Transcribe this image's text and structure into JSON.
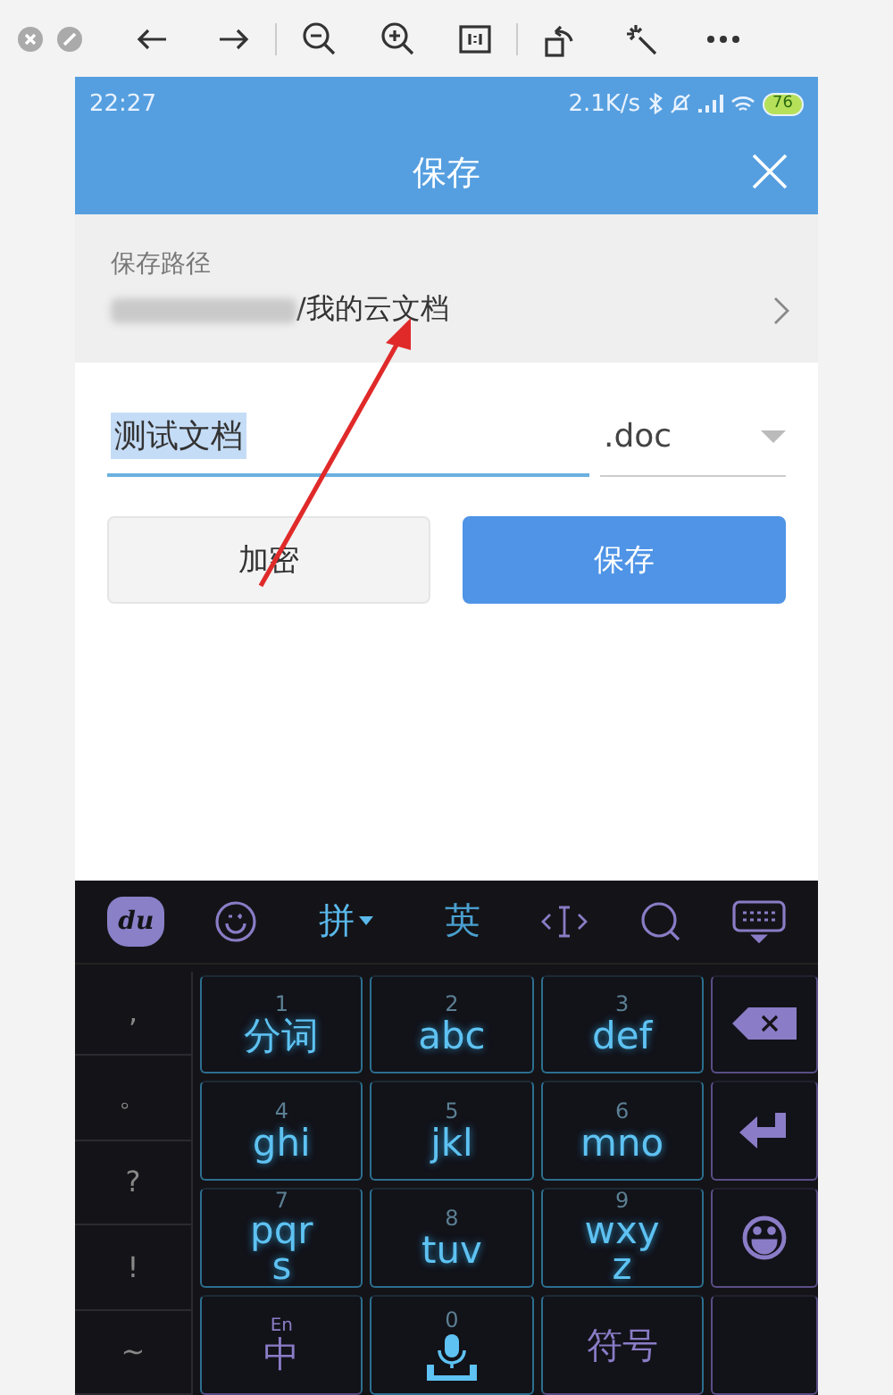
{
  "status_bar": {
    "time": "22:27",
    "speed": "2.1K/s",
    "battery": "76"
  },
  "header": {
    "title": "保存"
  },
  "save_path": {
    "label": "保存路径",
    "path": "/我的云文档"
  },
  "file_name": {
    "value": "测试文档",
    "highlighted": true
  },
  "format": {
    "value": ".doc"
  },
  "buttons": [
    {
      "label": "加密",
      "kind": "secondary"
    },
    {
      "label": "保存",
      "kind": "primary"
    }
  ],
  "keyboard": {
    "logo": "du",
    "toolbar": [
      {
        "kind": "emoji"
      },
      {
        "kind": "label",
        "label": "拼",
        "dropdown": true,
        "selected": true
      },
      {
        "kind": "label",
        "label": "英",
        "dropdown": false,
        "selected": false
      },
      {
        "kind": "cursor"
      },
      {
        "kind": "search"
      },
      {
        "kind": "hide"
      }
    ],
    "symbols": [
      ",",
      "。",
      "?",
      "!",
      "~"
    ],
    "keys": [
      {
        "kind": "t9",
        "number": "1",
        "label": "分词",
        "wrap": false
      },
      {
        "kind": "t9",
        "number": "2",
        "label": "abc",
        "wrap": false
      },
      {
        "kind": "t9",
        "number": "3",
        "label": "def",
        "wrap": false
      },
      {
        "kind": "backspace"
      },
      {
        "kind": "t9",
        "number": "4",
        "label": "ghi",
        "wrap": false
      },
      {
        "kind": "t9",
        "number": "5",
        "label": "jkl",
        "wrap": false
      },
      {
        "kind": "t9",
        "number": "6",
        "label": "mno",
        "wrap": false
      },
      {
        "kind": "enter"
      },
      {
        "kind": "t9",
        "number": "7",
        "label": "pqrs",
        "wrap": true
      },
      {
        "kind": "t9",
        "number": "8",
        "label": "tuv",
        "wrap": false
      },
      {
        "kind": "t9",
        "number": "9",
        "label": "wxyz",
        "wrap": true
      },
      {
        "kind": "emoji"
      },
      {
        "kind": "lang",
        "super": "En",
        "label": "中"
      },
      {
        "kind": "voice",
        "number": "0"
      },
      {
        "kind": "symbol",
        "label": "符号"
      },
      {
        "kind": "blank"
      }
    ]
  }
}
